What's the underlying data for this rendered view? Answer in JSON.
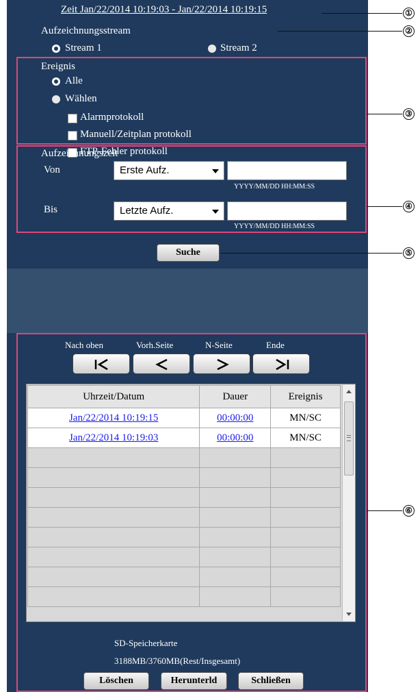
{
  "header": {
    "time_range": "Zeit Jan/22/2014 10:19:03 - Jan/22/2014 10:19:15"
  },
  "stream": {
    "title": "Aufzeichnungsstream",
    "options": [
      {
        "label": "Stream 1",
        "selected": true
      },
      {
        "label": "Stream 2",
        "selected": false
      }
    ]
  },
  "event": {
    "title": "Ereignis",
    "all_label": "Alle",
    "select_label": "Wählen",
    "types": [
      "Alarmprotokoll",
      "Manuell/Zeitplan protokoll",
      "FTP-Fehler protokoll"
    ]
  },
  "rec_time": {
    "title": "Aufzeichnungszeit",
    "from_label": "Von",
    "from_select": "Erste Aufz.",
    "to_label": "Bis",
    "to_select": "Letzte Aufz.",
    "format_hint": "YYYY/MM/DD HH:MM:SS"
  },
  "search_button": "Suche",
  "nav": {
    "labels": [
      "Nach oben",
      "Vorh.Seite",
      "N-Seite",
      "Ende"
    ],
    "icons": [
      "first-page-icon",
      "previous-page-icon",
      "next-page-icon",
      "last-page-icon"
    ]
  },
  "table": {
    "headers": [
      "Uhrzeit/Datum",
      "Dauer",
      "Ereignis"
    ],
    "rows": [
      [
        "Jan/22/2014  10:19:15",
        "00:00:00",
        "MN/SC"
      ],
      [
        "Jan/22/2014  10:19:03",
        "00:00:00",
        "MN/SC"
      ]
    ],
    "empty_rows": 9
  },
  "footer": {
    "storage_label": "SD-Speicherkarte",
    "storage_value": "3188MB/3760MB(Rest/Insgesamt)",
    "buttons": [
      "Löschen",
      "Herunterld",
      "Schließen"
    ]
  },
  "callouts": [
    "①",
    "②",
    "③",
    "④",
    "⑤",
    "⑥"
  ],
  "colors": {
    "panel": "#1f3a5c",
    "separator": "#35506f",
    "highlight": "#e0457b",
    "link": "#1a1aee"
  }
}
